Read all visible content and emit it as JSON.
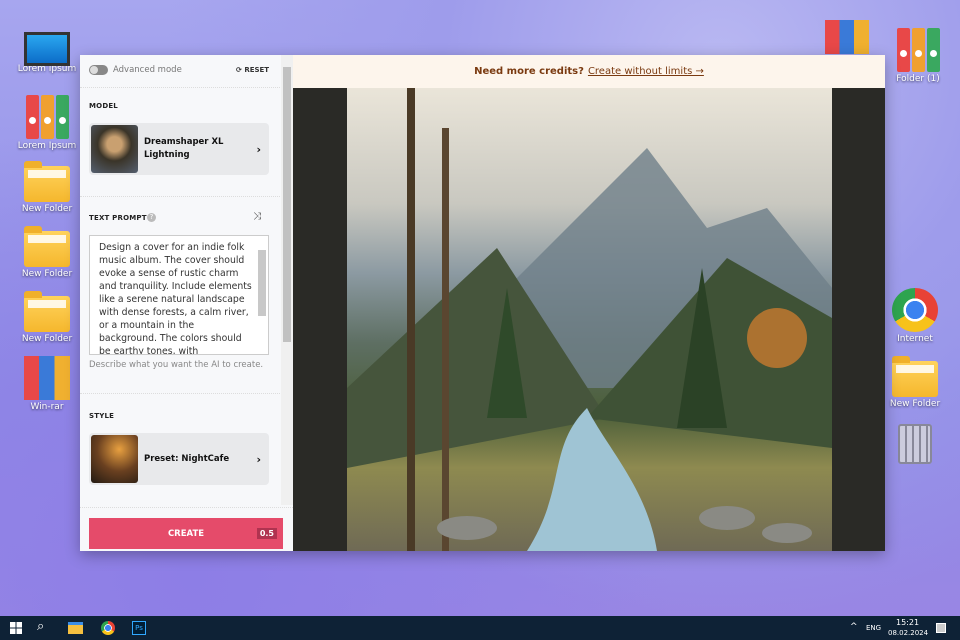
{
  "desktop": {
    "left_icons": [
      "Lorem Ipsum",
      "Lorem Ipsum",
      "New Folder",
      "New Folder",
      "New Folder",
      "Win-rar"
    ],
    "right_icons": [
      "Folder (1)",
      "Internet",
      "New Folder"
    ]
  },
  "app": {
    "advanced_mode": "Advanced mode",
    "advanced_mode_on": false,
    "reset": "RESET",
    "model_label": "MODEL",
    "model_name": "Dreamshaper XL Lightning",
    "prompt_label": "TEXT PROMPT",
    "prompt_text": "Design a cover for an indie folk music album. The cover should evoke a sense of rustic charm and tranquility. Include elements like a serene natural landscape with dense forests, a calm river, or a mountain in the background. The colors should be earthy tones, with",
    "prompt_hint": "Describe what you want the AI to create.",
    "style_label": "STYLE",
    "style_name": "Preset: NightCafe",
    "create": "CREATE",
    "create_cost": "0.5",
    "banner_text": "Need more credits?",
    "banner_link": "Create without limits →"
  },
  "taskbar": {
    "lang": "ENG",
    "time": "15:21",
    "date": "08.02.2024"
  },
  "colors": {
    "accent": "#e54b6a",
    "taskbar": "#0e2236"
  }
}
